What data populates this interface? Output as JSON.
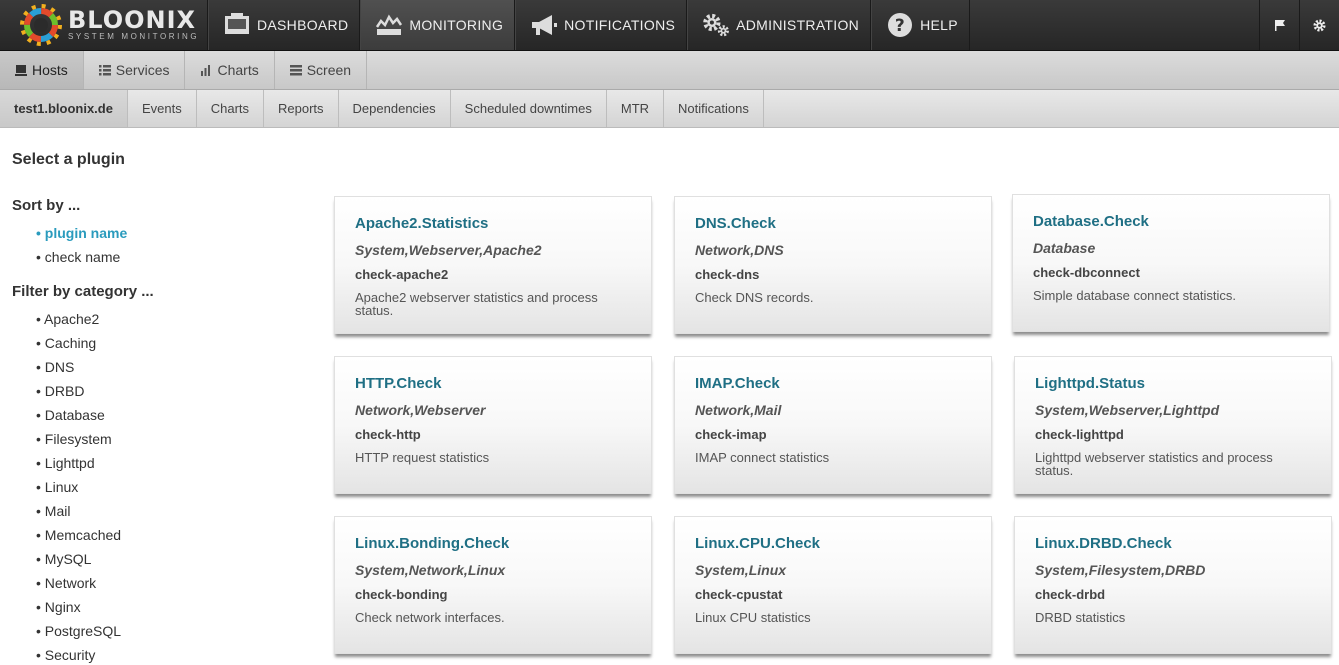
{
  "app": {
    "logo_name": "BLOONIX",
    "logo_sub": "SYSTEM MONITORING"
  },
  "topnav": [
    {
      "label": "DASHBOARD",
      "icon": "dashboard-icon"
    },
    {
      "label": "MONITORING",
      "icon": "monitoring-icon"
    },
    {
      "label": "NOTIFICATIONS",
      "icon": "megaphone-icon"
    },
    {
      "label": "ADMINISTRATION",
      "icon": "gears-icon"
    },
    {
      "label": "HELP",
      "icon": "help-icon"
    }
  ],
  "tabs": [
    {
      "label": "Hosts",
      "icon": "host-icon"
    },
    {
      "label": "Services",
      "icon": "list-icon"
    },
    {
      "label": "Charts",
      "icon": "bar-chart-icon"
    },
    {
      "label": "Screen",
      "icon": "screen-icon"
    }
  ],
  "subtabs": [
    "test1.bloonix.de",
    "Events",
    "Charts",
    "Reports",
    "Dependencies",
    "Scheduled downtimes",
    "MTR",
    "Notifications"
  ],
  "page": {
    "title": "Select a plugin",
    "sort_heading": "Sort by ...",
    "sort_options": [
      "plugin name",
      "check name"
    ],
    "filter_heading": "Filter by category ...",
    "categories": [
      "Apache2",
      "Caching",
      "DNS",
      "DRBD",
      "Database",
      "Filesystem",
      "Lighttpd",
      "Linux",
      "Mail",
      "Memcached",
      "MySQL",
      "Network",
      "Nginx",
      "PostgreSQL",
      "Security"
    ]
  },
  "plugins": [
    {
      "name": "Apache2.Statistics",
      "categories": "System,Webserver,Apache2",
      "command": "check-apache2",
      "description": "Apache2 webserver statistics and process status."
    },
    {
      "name": "DNS.Check",
      "categories": "Network,DNS",
      "command": "check-dns",
      "description": "Check DNS records."
    },
    {
      "name": "Database.Check",
      "categories": "Database",
      "command": "check-dbconnect",
      "description": "Simple database connect statistics."
    },
    {
      "name": "HTTP.Check",
      "categories": "Network,Webserver",
      "command": "check-http",
      "description": "HTTP request statistics"
    },
    {
      "name": "IMAP.Check",
      "categories": "Network,Mail",
      "command": "check-imap",
      "description": "IMAP connect statistics"
    },
    {
      "name": "Lighttpd.Status",
      "categories": "System,Webserver,Lighttpd",
      "command": "check-lighttpd",
      "description": "Lighttpd webserver statistics and process status."
    },
    {
      "name": "Linux.Bonding.Check",
      "categories": "System,Network,Linux",
      "command": "check-bonding",
      "description": "Check network interfaces."
    },
    {
      "name": "Linux.CPU.Check",
      "categories": "System,Linux",
      "command": "check-cpustat",
      "description": "Linux CPU statistics"
    },
    {
      "name": "Linux.DRBD.Check",
      "categories": "System,Filesystem,DRBD",
      "command": "check-drbd",
      "description": "DRBD statistics"
    }
  ]
}
